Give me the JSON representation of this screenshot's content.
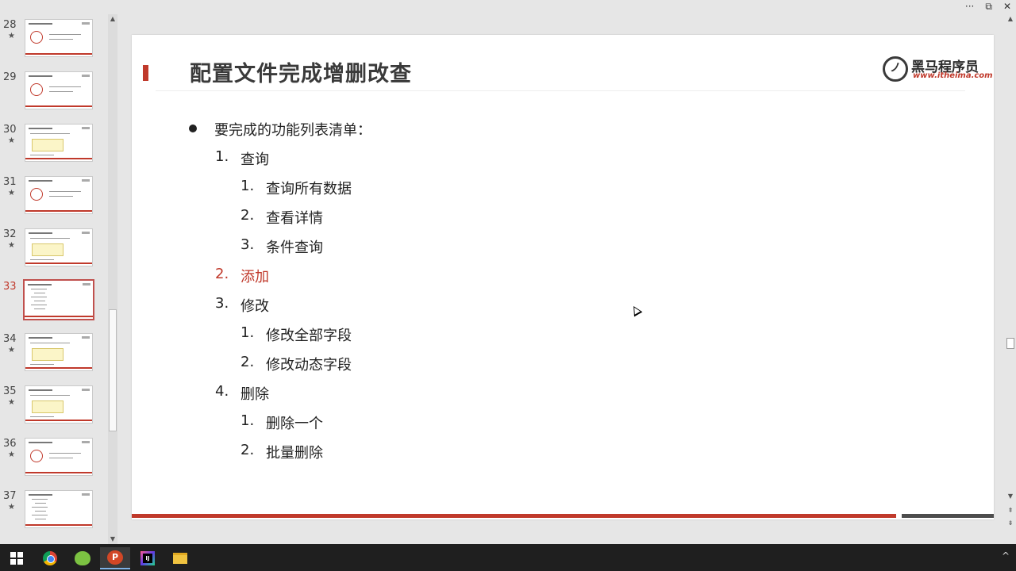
{
  "window_controls": {
    "more": "···",
    "restore": "⧉",
    "close": "✕"
  },
  "thumbnails": [
    {
      "number": "28",
      "star": "★",
      "active": false,
      "style": "circle"
    },
    {
      "number": "29",
      "star": "",
      "active": false,
      "style": "circle"
    },
    {
      "number": "30",
      "star": "★",
      "active": false,
      "style": "box"
    },
    {
      "number": "31",
      "star": "★",
      "active": false,
      "style": "circle"
    },
    {
      "number": "32",
      "star": "★",
      "active": false,
      "style": "box"
    },
    {
      "number": "33",
      "star": "",
      "active": true,
      "style": "list"
    },
    {
      "number": "34",
      "star": "★",
      "active": false,
      "style": "box"
    },
    {
      "number": "35",
      "star": "★",
      "active": false,
      "style": "box"
    },
    {
      "number": "36",
      "star": "★",
      "active": false,
      "style": "circle"
    },
    {
      "number": "37",
      "star": "★",
      "active": false,
      "style": "list"
    }
  ],
  "slide": {
    "title": "配置文件完成增删改查",
    "logo": {
      "mark": "ノ",
      "name": "黑马程序员",
      "url": "www.itheima.com"
    },
    "bullet": "要完成的功能列表清单：",
    "items": [
      {
        "level": 1,
        "num": "1.",
        "text": "查询",
        "highlight": false
      },
      {
        "level": 2,
        "num": "1.",
        "text": "查询所有数据",
        "highlight": false
      },
      {
        "level": 2,
        "num": "2.",
        "text": "查看详情",
        "highlight": false
      },
      {
        "level": 2,
        "num": "3.",
        "text": "条件查询",
        "highlight": false
      },
      {
        "level": 1,
        "num": "2.",
        "text": "添加",
        "highlight": true
      },
      {
        "level": 1,
        "num": "3.",
        "text": "修改",
        "highlight": false
      },
      {
        "level": 2,
        "num": "1.",
        "text": "修改全部字段",
        "highlight": false
      },
      {
        "level": 2,
        "num": "2.",
        "text": "修改动态字段",
        "highlight": false
      },
      {
        "level": 1,
        "num": "4.",
        "text": "删除",
        "highlight": false
      },
      {
        "level": 2,
        "num": "1.",
        "text": "删除一个",
        "highlight": false
      },
      {
        "level": 2,
        "num": "2.",
        "text": "批量删除",
        "highlight": false
      }
    ]
  },
  "colors": {
    "accent": "#c0392b",
    "dark_bar": "#4d4d4d"
  },
  "taskbar": {
    "icons": [
      "windows-start-icon",
      "chrome-icon",
      "app-frog-icon",
      "powerpoint-icon",
      "intellij-icon",
      "file-explorer-icon"
    ],
    "ppt_label": "P",
    "tray_chevron": "^"
  }
}
